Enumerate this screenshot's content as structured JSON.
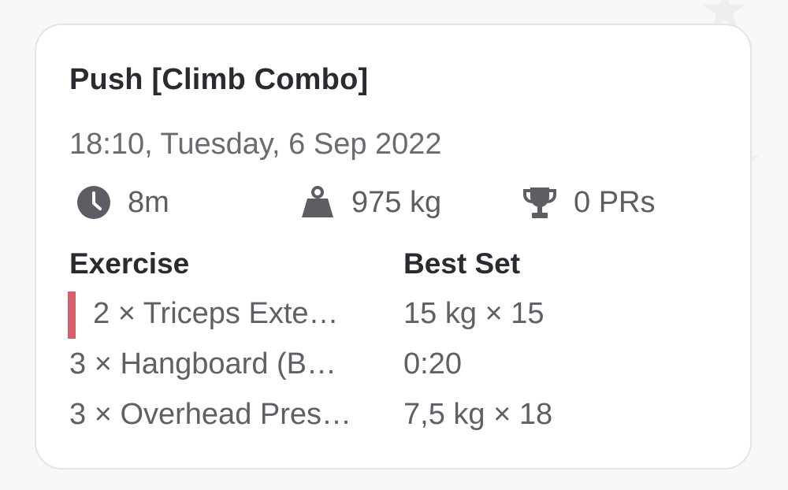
{
  "workout": {
    "title": "Push [Climb Combo]",
    "datetime": "18:10, Tuesday, 6 Sep 2022"
  },
  "stats": {
    "duration": "8m",
    "volume": "975 kg",
    "prs": "0 PRs",
    "icons": [
      "clock-icon",
      "weight-icon",
      "trophy-icon"
    ]
  },
  "table": {
    "headers": {
      "exercise": "Exercise",
      "best_set": "Best Set"
    },
    "rows": [
      {
        "exercise": "2 × Triceps Exte…",
        "best_set": "15 kg × 15",
        "highlighted": true
      },
      {
        "exercise": "3 × Hangboard (B…",
        "best_set": "0:20",
        "highlighted": false
      },
      {
        "exercise": "3 × Overhead Pres…",
        "best_set": "7,5 kg × 18",
        "highlighted": false
      }
    ]
  },
  "colors": {
    "accent": "#d2616c",
    "icon": "#5d5e63",
    "title": "#2a2b30",
    "text": "#5f6065"
  }
}
